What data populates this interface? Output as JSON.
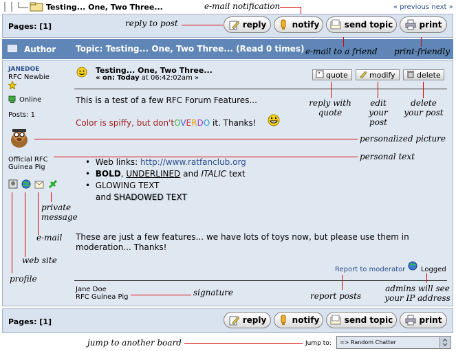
{
  "breadcrumb": {
    "title": "Testing... One, Two Three..."
  },
  "pager": {
    "previous": "« previous",
    "next": "next »"
  },
  "top_toolbar": {
    "pages_label": "Pages: [1]"
  },
  "buttons": {
    "reply": "reply",
    "notify": "notify",
    "send_topic": "send topic",
    "print": "print"
  },
  "header": {
    "author": "Author",
    "topic": "Topic: Testing... One, Two Three...  (Read 0 times)"
  },
  "author": {
    "name": "JANEDOE",
    "rank": "RFC Newbie",
    "status": "Online",
    "posts": "Posts: 1",
    "personal_text": "Official RFC Guinea Pig"
  },
  "post": {
    "subject": "Testing... One, Two Three...",
    "on_label": "« on:",
    "date": "Today",
    "time": "at 06:42:02am »",
    "intro": "This is a test of a few RFC Forum Features...",
    "color_prefix": "Color is spiffy, but don't",
    "color_word": [
      "O",
      "V",
      "E",
      "R",
      "D",
      "O"
    ],
    "color_suffix": "it. Thanks!",
    "list": {
      "weblinks_label": "Web links:",
      "weblinks_url": "http://www.ratfanclub.org",
      "bold": "BOLD",
      "sep1": ",",
      "underlined": "UNDERLINED",
      "and": "and",
      "italic": "ITALIC",
      "text": "text",
      "glowing": "GLOWING TEXT",
      "and2": "and",
      "shadowed": "SHADOWED TEXT"
    },
    "closing": "These are just a few features... we have lots of toys now, but please use them in moderation... Thanks!",
    "report": "Report to moderator",
    "logged": "Logged",
    "signature_line1": "Jane Doe",
    "signature_line2": "RFC Guinea Pig"
  },
  "small_buttons": {
    "quote": "quote",
    "modify": "modify",
    "delete": "delete"
  },
  "bottom_toolbar": {
    "pages_label": "Pages: [1]"
  },
  "jump": {
    "label": "Jump to:",
    "selected": "=> Random Chatter"
  },
  "annotations": {
    "email_notification": "e-mail notification",
    "reply_to_post": "reply to post",
    "email_friend": "e-mail to a friend",
    "print_friendly": "print-friendly",
    "reply_quote": "reply with quote",
    "edit_post": "edit your post",
    "delete_post": "delete your post",
    "personalized_picture": "personalized picture",
    "personal_text": "personal text",
    "private_message": "private message",
    "email": "e-mail",
    "website": "web site",
    "profile": "profile",
    "signature": "signature",
    "report_posts": "report posts",
    "admins_ip": "admins will see your IP address",
    "jump_board": "jump to another board"
  },
  "colors": {
    "header_bg": "#5f86b6",
    "post_bg": "#dfe7f1",
    "toolbar_bg": "#d9e3ef",
    "annotation_line": "#dd0000"
  }
}
